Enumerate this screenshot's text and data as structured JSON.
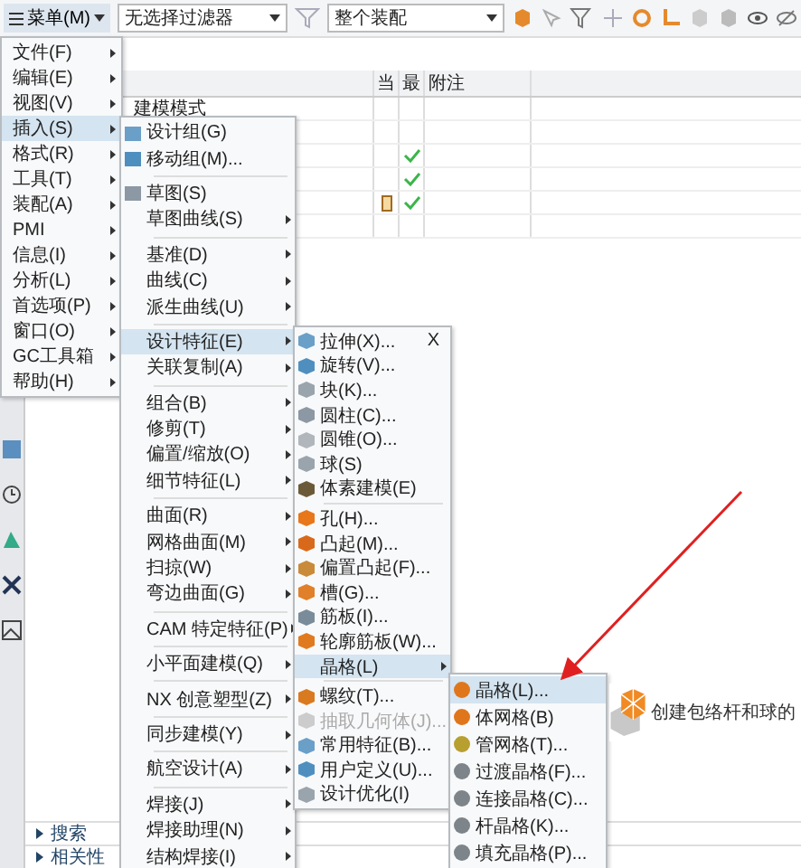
{
  "toolbar": {
    "menu_button": "菜单(M)",
    "selection_filter": "无选择过滤器",
    "assembly_scope": "整个装配"
  },
  "navigator": {
    "columns": [
      "当",
      "最",
      "附注"
    ],
    "rows": [
      {
        "name": "建模模式",
        "current": false,
        "up_to_date": false
      },
      {
        "current": false,
        "up_to_date": false
      },
      {
        "current": false,
        "up_to_date": true
      },
      {
        "current": false,
        "up_to_date": true
      },
      {
        "current": true,
        "up_to_date": true
      },
      {
        "current": false,
        "up_to_date": false
      }
    ],
    "panels": [
      "搜索",
      "相关性"
    ]
  },
  "main_menu": [
    {
      "label": "文件(F)",
      "selected": false
    },
    {
      "label": "编辑(E)",
      "selected": false
    },
    {
      "label": "视图(V)",
      "selected": false
    },
    {
      "label": "插入(S)",
      "selected": true
    },
    {
      "label": "格式(R)",
      "selected": false
    },
    {
      "label": "工具(T)",
      "selected": false
    },
    {
      "label": "装配(A)",
      "selected": false
    },
    {
      "label": "PMI",
      "selected": false
    },
    {
      "label": "信息(I)",
      "selected": false
    },
    {
      "label": "分析(L)",
      "selected": false
    },
    {
      "label": "首选项(P)",
      "selected": false
    },
    {
      "label": "窗口(O)",
      "selected": false
    },
    {
      "label": "GC工具箱",
      "selected": false
    },
    {
      "label": "帮助(H)",
      "selected": false
    }
  ],
  "insert_menu": [
    {
      "kind": "command",
      "label": "设计组(G)",
      "selected": false
    },
    {
      "kind": "command",
      "label": "移动组(M)...",
      "selected": false
    },
    {
      "kind": "separator"
    },
    {
      "kind": "command",
      "label": "草图(S)",
      "selected": false
    },
    {
      "kind": "submenu",
      "label": "草图曲线(S)",
      "selected": false
    },
    {
      "kind": "separator"
    },
    {
      "kind": "submenu",
      "label": "基准(D)",
      "selected": false
    },
    {
      "kind": "submenu",
      "label": "曲线(C)",
      "selected": false
    },
    {
      "kind": "submenu",
      "label": "派生曲线(U)",
      "selected": false
    },
    {
      "kind": "separator"
    },
    {
      "kind": "submenu",
      "label": "设计特征(E)",
      "selected": true
    },
    {
      "kind": "submenu",
      "label": "关联复制(A)",
      "selected": false
    },
    {
      "kind": "separator"
    },
    {
      "kind": "submenu",
      "label": "组合(B)",
      "selected": false
    },
    {
      "kind": "submenu",
      "label": "修剪(T)",
      "selected": false
    },
    {
      "kind": "submenu",
      "label": "偏置/缩放(O)",
      "selected": false
    },
    {
      "kind": "submenu",
      "label": "细节特征(L)",
      "selected": false
    },
    {
      "kind": "separator"
    },
    {
      "kind": "submenu",
      "label": "曲面(R)",
      "selected": false
    },
    {
      "kind": "submenu",
      "label": "网格曲面(M)",
      "selected": false
    },
    {
      "kind": "submenu",
      "label": "扫掠(W)",
      "selected": false
    },
    {
      "kind": "submenu",
      "label": "弯边曲面(G)",
      "selected": false
    },
    {
      "kind": "separator"
    },
    {
      "kind": "submenu",
      "label": "CAM 特定特征(P)",
      "selected": false
    },
    {
      "kind": "separator"
    },
    {
      "kind": "submenu",
      "label": "小平面建模(Q)",
      "selected": false
    },
    {
      "kind": "separator"
    },
    {
      "kind": "submenu",
      "label": "NX 创意塑型(Z)",
      "selected": false
    },
    {
      "kind": "separator"
    },
    {
      "kind": "submenu",
      "label": "同步建模(Y)",
      "selected": false
    },
    {
      "kind": "separator"
    },
    {
      "kind": "submenu",
      "label": "航空设计(A)",
      "selected": false
    },
    {
      "kind": "separator"
    },
    {
      "kind": "submenu",
      "label": "焊接(J)",
      "selected": false
    },
    {
      "kind": "submenu",
      "label": "焊接助理(N)",
      "selected": false
    },
    {
      "kind": "submenu",
      "label": "结构焊接(I)",
      "selected": false
    }
  ],
  "design_feature_menu": [
    {
      "kind": "command",
      "label": "拉伸(X)...",
      "shortcut": "X",
      "selected": false,
      "disabled": false
    },
    {
      "kind": "command",
      "label": "旋转(V)...",
      "selected": false,
      "disabled": false
    },
    {
      "kind": "command",
      "label": "块(K)...",
      "selected": false,
      "disabled": false
    },
    {
      "kind": "command",
      "label": "圆柱(C)...",
      "selected": false,
      "disabled": false
    },
    {
      "kind": "command",
      "label": "圆锥(O)...",
      "selected": false,
      "disabled": false
    },
    {
      "kind": "command",
      "label": "球(S)",
      "selected": false,
      "disabled": false
    },
    {
      "kind": "command",
      "label": "体素建模(E)",
      "selected": false,
      "disabled": false
    },
    {
      "kind": "separator"
    },
    {
      "kind": "command",
      "label": "孔(H)...",
      "selected": false,
      "disabled": false
    },
    {
      "kind": "command",
      "label": "凸起(M)...",
      "selected": false,
      "disabled": false
    },
    {
      "kind": "command",
      "label": "偏置凸起(F)...",
      "selected": false,
      "disabled": false
    },
    {
      "kind": "command",
      "label": "槽(G)...",
      "selected": false,
      "disabled": false
    },
    {
      "kind": "command",
      "label": "筋板(I)...",
      "selected": false,
      "disabled": false
    },
    {
      "kind": "command",
      "label": "轮廓筋板(W)...",
      "selected": false,
      "disabled": false
    },
    {
      "kind": "submenu",
      "label": "晶格(L)",
      "selected": true,
      "disabled": false
    },
    {
      "kind": "separator"
    },
    {
      "kind": "command",
      "label": "螺纹(T)...",
      "selected": false,
      "disabled": false
    },
    {
      "kind": "command",
      "label": "抽取几何体(J)...",
      "selected": false,
      "disabled": true
    },
    {
      "kind": "command",
      "label": "常用特征(B)...",
      "selected": false,
      "disabled": false
    },
    {
      "kind": "command",
      "label": "用户定义(U)...",
      "selected": false,
      "disabled": false
    },
    {
      "kind": "command",
      "label": "设计优化(I)",
      "selected": false,
      "disabled": false
    }
  ],
  "lattice_menu": [
    {
      "label": "晶格(L)...",
      "selected": true
    },
    {
      "label": "体网格(B)",
      "selected": false
    },
    {
      "label": "管网格(T)...",
      "selected": false
    },
    {
      "label": "过渡晶格(F)...",
      "selected": false
    },
    {
      "label": "连接晶格(C)...",
      "selected": false
    },
    {
      "label": "杆晶格(K)...",
      "selected": false
    },
    {
      "label": "填充晶格(P)...",
      "selected": false
    }
  ],
  "tooltip": {
    "text": "创建包络杆和球的"
  }
}
